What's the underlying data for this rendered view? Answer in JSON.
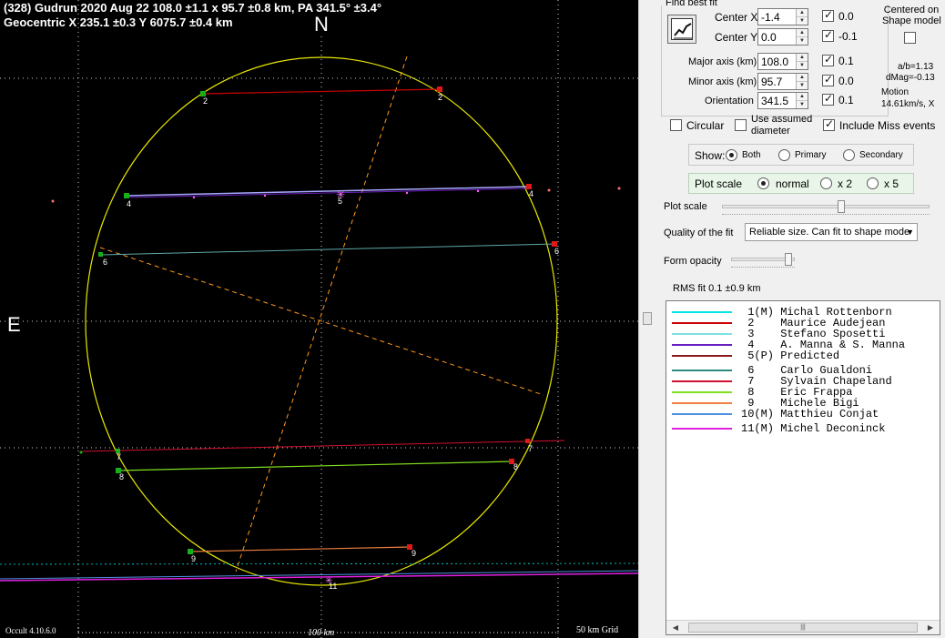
{
  "plot": {
    "header_line1": "(328) Gudrun  2020 Aug 22   108.0 ±1.1 x 95.7 ±0.8 km,  PA 341.5° ±3.4°",
    "header_line2": "Geocentric  X  235.1 ±0.3  Y 6075.7 ±0.4 km",
    "north_label": "N",
    "east_label": "E",
    "version": "Occult 4.10.6.0",
    "scale_label": "100 km",
    "grid_label": "50 km Grid",
    "chord_labels": [
      {
        "id": "2",
        "text": "2"
      },
      {
        "id": "2b",
        "text": "2"
      },
      {
        "id": "4",
        "text": "4"
      },
      {
        "id": "4b",
        "text": "4"
      },
      {
        "id": "5",
        "text": "5"
      },
      {
        "id": "6",
        "text": "6"
      },
      {
        "id": "6b",
        "text": "6"
      },
      {
        "id": "7",
        "text": "7"
      },
      {
        "id": "7b",
        "text": "7"
      },
      {
        "id": "8",
        "text": "8"
      },
      {
        "id": "8b",
        "text": "8"
      },
      {
        "id": "9",
        "text": "9"
      },
      {
        "id": "9b",
        "text": "9"
      },
      {
        "id": "11",
        "text": "11"
      }
    ]
  },
  "panel": {
    "find_best_fit": "Find best fit",
    "center_x_label": "Center X",
    "center_x_value": "-1.4",
    "center_x_uncert": "0.0",
    "center_y_label": "Center Y",
    "center_y_value": "0.0",
    "center_y_uncert": "-0.1",
    "centered_on_line1": "Centered on",
    "centered_on_line2": "Shape model",
    "major_label": "Major axis (km)",
    "major_value": "108.0",
    "major_uncert": "0.1",
    "minor_label": "Minor axis (km)",
    "minor_value": "95.7",
    "minor_uncert": "0.0",
    "orient_label": "Orientation",
    "orient_value": "341.5",
    "orient_uncert": "0.1",
    "ab_ratio": "a/b=1.13",
    "dmag": "dMag=-0.13",
    "motion_label": "Motion",
    "motion_value": "14.61km/s, X",
    "circular": "Circular",
    "use_assumed_line1": "Use assumed",
    "use_assumed_line2": "diameter",
    "include_miss": "Include Miss events",
    "show_label": "Show:",
    "show_both": "Both",
    "show_primary": "Primary",
    "show_secondary": "Secondary",
    "plot_scale_group": "Plot scale",
    "scale_normal": "normal",
    "scale_x2": "x 2",
    "scale_x5": "x 5",
    "plot_scale_slider": "Plot scale",
    "quality_label": "Quality of the fit",
    "quality_value": "Reliable size. Can fit to shape mode",
    "form_opacity": "Form opacity",
    "rms_fit": "RMS fit 0.1 ±0.9 km"
  },
  "legend": [
    {
      "num": " 1",
      "tag": "(M)",
      "name": "Michal Rottenborn",
      "color": "#00e5e5"
    },
    {
      "num": " 2",
      "tag": "   ",
      "name": "Maurice Audejean",
      "color": "#cc0000"
    },
    {
      "num": " 3",
      "tag": "   ",
      "name": "Stefano Sposetti",
      "color": "#7fe0e0"
    },
    {
      "num": " 4",
      "tag": "   ",
      "name": "A. Manna & S. Manna",
      "color": "#6a1fc0"
    },
    {
      "num": " 5",
      "tag": "(P)",
      "name": "Predicted",
      "color": "#8b1a1a"
    },
    {
      "num": " 6",
      "tag": "   ",
      "name": "Carlo Gualdoni",
      "color": "#2e8b80"
    },
    {
      "num": " 7",
      "tag": "   ",
      "name": "Sylvain Chapeland",
      "color": "#d01030"
    },
    {
      "num": " 8",
      "tag": "   ",
      "name": "Eric Frappa",
      "color": "#80e020"
    },
    {
      "num": " 9",
      "tag": "   ",
      "name": "Michele Bigi",
      "color": "#f08040"
    },
    {
      "num": "10",
      "tag": "(M)",
      "name": "Matthieu Conjat",
      "color": "#5090e0"
    },
    {
      "num": "11",
      "tag": "(M)",
      "name": "Michel Deconinck",
      "color": "#e020e0"
    }
  ],
  "colors": {
    "ellipse": "#e8e800",
    "axis_dashed": "#ff9a1a",
    "chord_end_green": "#18b018",
    "chord_end_red": "#e01818"
  }
}
